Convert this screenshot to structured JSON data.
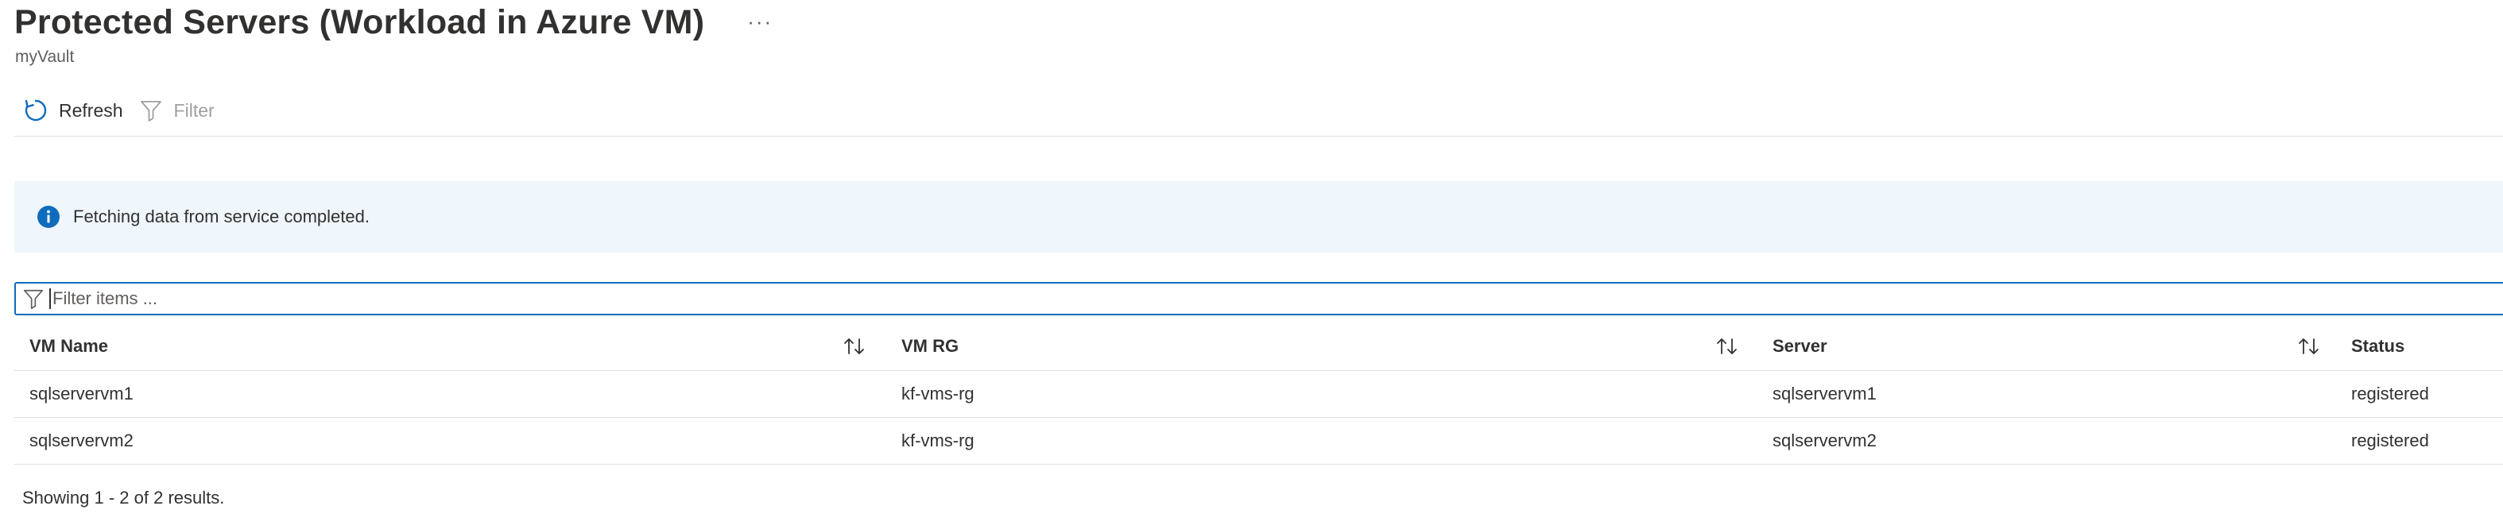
{
  "header": {
    "title": "Protected Servers (Workload in Azure VM)",
    "more_label": "···",
    "subtitle": "myVault"
  },
  "toolbar": {
    "refresh_label": "Refresh",
    "refresh_icon": "refresh-icon",
    "filter_label": "Filter",
    "filter_icon": "filter-icon",
    "filter_enabled": false
  },
  "info": {
    "icon": "info-icon",
    "message": "Fetching data from service completed."
  },
  "filter_input": {
    "placeholder": "Filter items ...",
    "value": ""
  },
  "table": {
    "columns": [
      "VM Name",
      "VM RG",
      "Server",
      "Status"
    ],
    "rows": [
      [
        "sqlservervm1",
        "kf-vms-rg",
        "sqlservervm1",
        "registered"
      ],
      [
        "sqlservervm2",
        "kf-vms-rg",
        "sqlservervm2",
        "registered"
      ]
    ]
  },
  "footer": {
    "results_text": "Showing 1 - 2 of 2 results."
  },
  "colors": {
    "accent": "#0f6cbd",
    "info_background": "#eff6fc",
    "disabled_text": "#a19f9d"
  }
}
